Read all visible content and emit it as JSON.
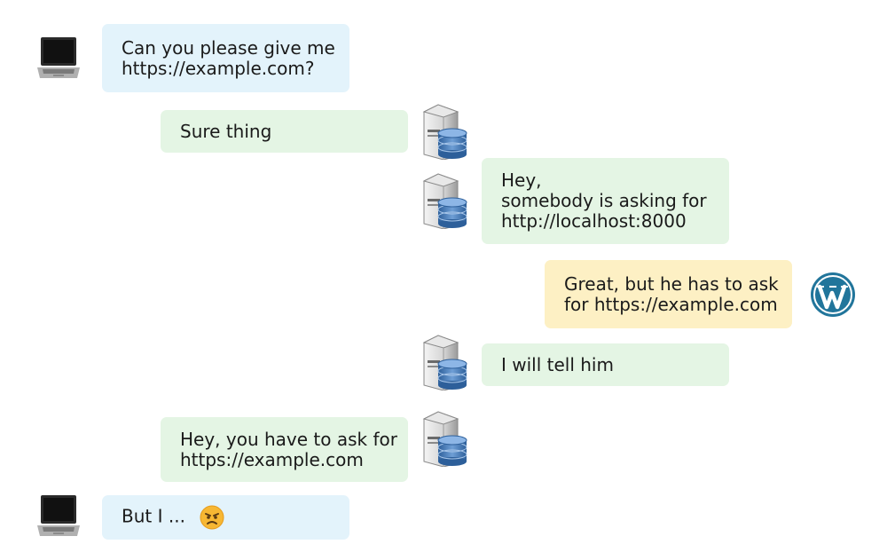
{
  "messages": [
    {
      "from": "laptop",
      "lines": [
        "Can you please give me",
        "https://example.com?"
      ]
    },
    {
      "from": "server-to-client",
      "lines": [
        "Sure thing"
      ]
    },
    {
      "from": "server-to-wordpress",
      "lines": [
        "Hey,",
        "somebody is asking for",
        "http://localhost:8000"
      ]
    },
    {
      "from": "wordpress",
      "lines": [
        "Great, but he has to ask",
        "for https://example.com"
      ]
    },
    {
      "from": "server-to-wordpress",
      "lines": [
        "I will tell him"
      ]
    },
    {
      "from": "server-to-client",
      "lines": [
        "Hey, you have to ask for",
        "https://example.com"
      ]
    },
    {
      "from": "laptop",
      "lines": [
        "But I ..."
      ],
      "emoji": "angry-face-icon"
    }
  ],
  "colors": {
    "client_bubble": "#e3f3fb",
    "server_bubble": "#e4f5e4",
    "wordpress_bubble": "#fdf0c4",
    "wordpress_logo": "#21759b"
  }
}
